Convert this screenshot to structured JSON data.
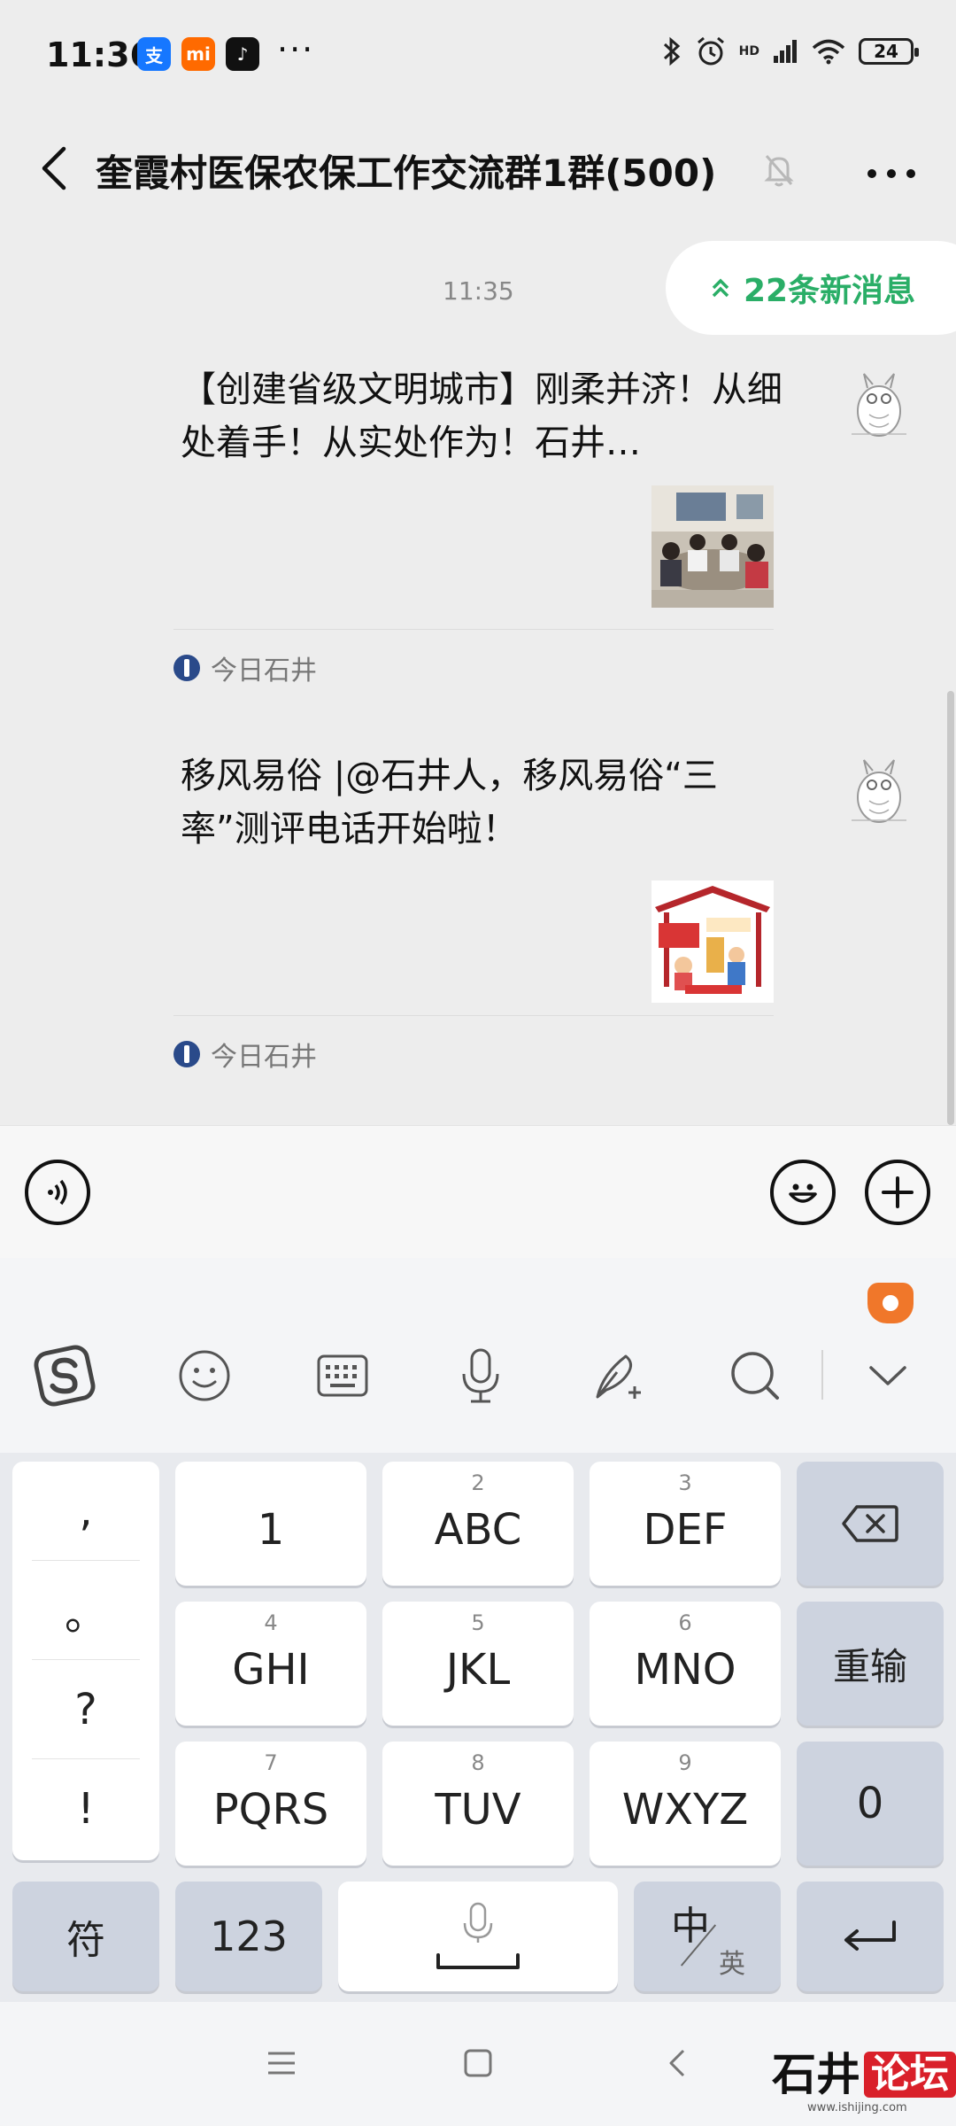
{
  "status_bar": {
    "time": "11:36",
    "more": "···",
    "network": "HD",
    "battery": "24"
  },
  "title_bar": {
    "title": "奎霞村医保农保工作交流群1群(500)"
  },
  "chat": {
    "timestamp": "11:35",
    "new_messages": "22条新消息",
    "cards": [
      {
        "title": "【创建省级文明城市】刚柔并济！从细处着手！从实处作为！石井…",
        "source": "今日石井"
      },
      {
        "title": "移风易俗 |@石井人，移风易俗“三率”测评电话开始啦！",
        "source": "今日石井"
      }
    ]
  },
  "keyboard": {
    "punctuation": [
      ",",
      "。",
      "?",
      "!"
    ],
    "rows": [
      [
        {
          "num": "",
          "label": "1"
        },
        {
          "num": "2",
          "label": "ABC"
        },
        {
          "num": "3",
          "label": "DEF"
        }
      ],
      [
        {
          "num": "4",
          "label": "GHI"
        },
        {
          "num": "5",
          "label": "JKL"
        },
        {
          "num": "6",
          "label": "MNO"
        }
      ],
      [
        {
          "num": "7",
          "label": "PQRS"
        },
        {
          "num": "8",
          "label": "TUV"
        },
        {
          "num": "9",
          "label": "WXYZ"
        }
      ]
    ],
    "reinput": "重输",
    "zero": "0",
    "symbols": "符",
    "numbers": "123",
    "lang_main": "中",
    "lang_alt": "英"
  },
  "watermark": {
    "text_a": "石井",
    "text_b": "论坛",
    "url": "www.ishijing.com"
  },
  "colors": {
    "accent_green": "#2aae67",
    "brand_red": "#d9202a",
    "ime_orange": "#f0772a"
  }
}
